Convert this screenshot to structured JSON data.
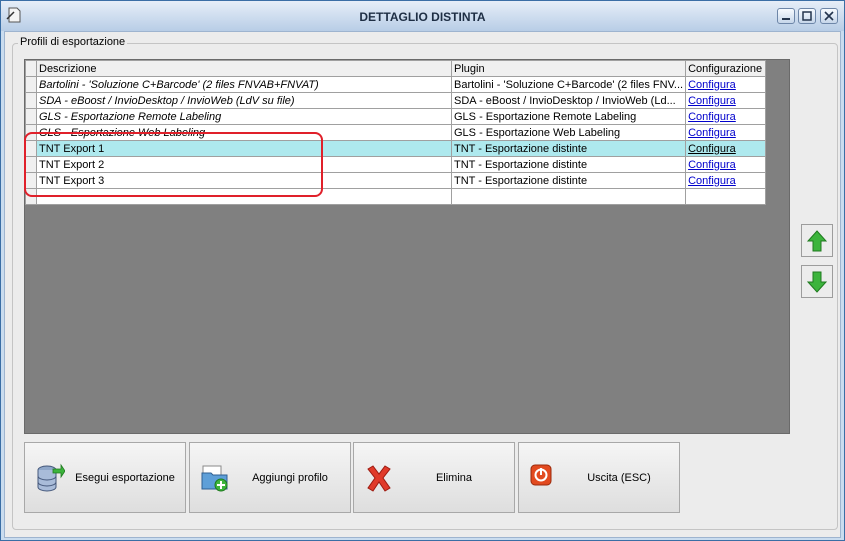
{
  "window": {
    "title": "DETTAGLIO DISTINTA"
  },
  "group": {
    "label": "Profili di esportazione"
  },
  "grid": {
    "headers": {
      "descrizione": "Descrizione",
      "plugin": "Plugin",
      "configurazione": "Configurazione"
    },
    "rows": [
      {
        "descrizione": "Bartolini - 'Soluzione C+Barcode' (2 files FNVAB+FNVAT)",
        "plugin": "Bartolini - 'Soluzione C+Barcode' (2 files FNV...",
        "configurazione": "Configura"
      },
      {
        "descrizione": "SDA - eBoost / InvioDesktop / InvioWeb (LdV su file)",
        "plugin": "SDA - eBoost / InvioDesktop / InvioWeb (Ld...",
        "configurazione": "Configura"
      },
      {
        "descrizione": "GLS - Esportazione Remote Labeling",
        "plugin": "GLS - Esportazione Remote Labeling",
        "configurazione": "Configura"
      },
      {
        "descrizione": "GLS - Esportazione Web Labeling",
        "plugin": "GLS - Esportazione Web Labeling",
        "configurazione": "Configura"
      },
      {
        "descrizione": "TNT Export 1",
        "plugin": "TNT - Esportazione distinte",
        "configurazione": "Configura"
      },
      {
        "descrizione": "TNT Export 2",
        "plugin": "TNT - Esportazione distinte",
        "configurazione": "Configura"
      },
      {
        "descrizione": "TNT Export 3",
        "plugin": "TNT - Esportazione distinte",
        "configurazione": "Configura"
      }
    ]
  },
  "buttons": {
    "esegui": "Esegui esportazione",
    "aggiungi": "Aggiungi profilo",
    "elimina": "Elimina",
    "uscita": "Uscita (ESC)"
  },
  "icons": {
    "app": "document-pin-icon",
    "move_up": "arrow-up-icon",
    "move_down": "arrow-down-icon",
    "esegui": "database-export-icon",
    "aggiungi": "folder-add-icon",
    "elimina": "red-x-icon",
    "uscita": "power-icon"
  },
  "colors": {
    "selection": "#aee9ee",
    "highlight_box": "#e0202a",
    "link": "#0000cc",
    "arrow_green": "#3cb43c"
  }
}
